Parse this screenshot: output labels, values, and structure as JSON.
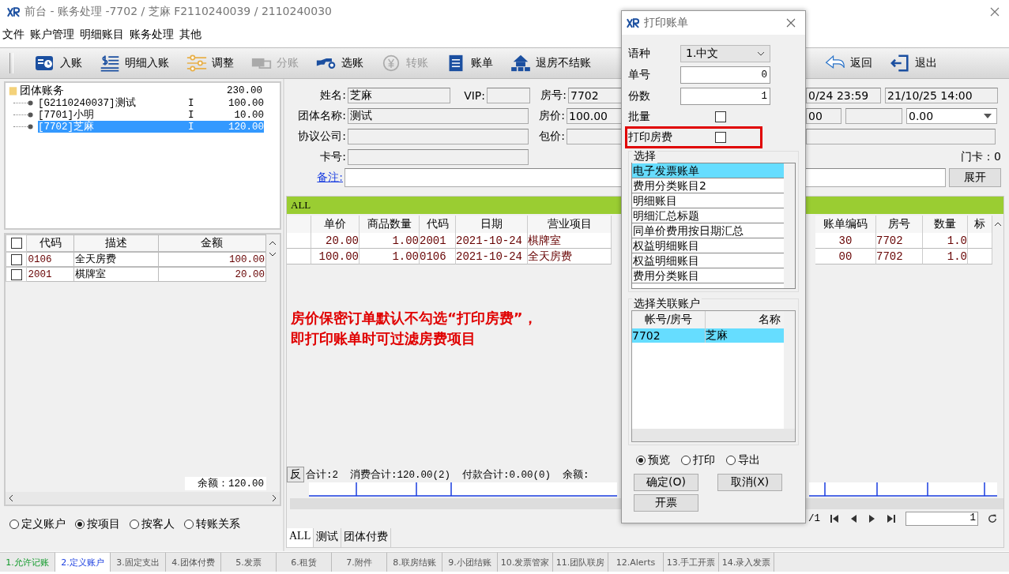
{
  "window": {
    "title": "前台 - 账务处理 -7702 / 芝麻 F2110240039 / 2110240030"
  },
  "menu": [
    "文件",
    "账户管理",
    "明细账目",
    "账务处理",
    "其他"
  ],
  "toolbar": [
    {
      "label": "入账",
      "disabled": false
    },
    {
      "label": "明细入账",
      "disabled": false
    },
    {
      "label": "调整",
      "disabled": false
    },
    {
      "label": "分账",
      "disabled": true
    },
    {
      "label": "选账",
      "disabled": false
    },
    {
      "label": "转账",
      "disabled": true
    },
    {
      "label": "账单",
      "disabled": false
    },
    {
      "label": "退房不结账",
      "disabled": false
    }
  ],
  "toolbar_right": [
    {
      "label": "返回"
    },
    {
      "label": "退出"
    }
  ],
  "account_tree": {
    "label": "团体账务",
    "amount": "230.00",
    "expanded": true,
    "children": [
      {
        "label": "[G2110240037]测试",
        "type": "I",
        "amount": "100.00",
        "selected": false
      },
      {
        "label": "[7701]小明",
        "type": "I",
        "amount": "10.00",
        "selected": false
      },
      {
        "label": "[7702]芝麻",
        "type": "I",
        "amount": "120.00",
        "selected": true
      }
    ]
  },
  "items_table": {
    "all_checked": false,
    "columns": [
      "代码",
      "描述",
      "金额"
    ],
    "rows": [
      {
        "checked": false,
        "cells": [
          "0106",
          "全天房费",
          "100.00"
        ]
      },
      {
        "checked": false,
        "cells": [
          "2001",
          "棋牌室",
          "20.00"
        ]
      }
    ],
    "balance": "余额：120.00"
  },
  "view_options": [
    {
      "label": "定义账户",
      "selected": false
    },
    {
      "label": "按项目",
      "selected": true
    },
    {
      "label": "按客人",
      "selected": false
    },
    {
      "label": "转账关系",
      "selected": false
    }
  ],
  "guest_form": {
    "rows": [
      {
        "left": [
          {
            "kind": "label",
            "text": "姓名:"
          },
          {
            "kind": "field",
            "value": "芝麻",
            "readonly": true
          },
          {
            "kind": "label",
            "text": "VIP:"
          },
          {
            "kind": "field",
            "readonly": true
          },
          {
            "kind": "label",
            "text": "房号:"
          },
          {
            "kind": "field",
            "value": "7702",
            "readonly": true
          }
        ],
        "right": [
          {
            "kind": "field",
            "value": "0/24 23:59",
            "readonly": true
          },
          {
            "kind": "field",
            "value": "21/10/25 14:00",
            "readonly": true
          }
        ]
      },
      {
        "left": [
          {
            "kind": "label",
            "text": "团体名称:"
          },
          {
            "kind": "field",
            "value": "测试",
            "readonly": true
          },
          {
            "kind": "label",
            "text": "房价:"
          },
          {
            "kind": "field",
            "value": "100.00",
            "readonly": true
          }
        ],
        "right": [
          {
            "kind": "field",
            "value": "00",
            "readonly": true
          },
          {
            "kind": "field",
            "readonly": true
          },
          {
            "kind": "select",
            "value": "0.00",
            "readonly": false
          }
        ]
      },
      {
        "left": [
          {
            "kind": "label",
            "text": "协议公司:"
          },
          {
            "kind": "field",
            "readonly": true
          },
          {
            "kind": "label",
            "text": "包价:"
          },
          {
            "kind": "field",
            "readonly": true
          }
        ],
        "right": [
          {
            "kind": "field",
            "readonly": true
          }
        ]
      },
      {
        "left": [
          {
            "kind": "label",
            "text": "卡号:"
          },
          {
            "kind": "field",
            "readonly": true
          }
        ],
        "right": [
          {
            "kind": "label",
            "text": "门卡：0"
          }
        ]
      },
      {
        "left": [
          {
            "kind": "link",
            "text": "备注:"
          },
          {
            "kind": "field",
            "readonly": false
          }
        ],
        "right": [
          {
            "kind": "button",
            "text": "展开"
          }
        ]
      }
    ]
  },
  "bill_grid": {
    "title": "ALL",
    "columns": [
      "单价",
      "商品数量",
      "代码",
      "日期",
      "营业项目"
    ],
    "right_columns": [
      "账单编码",
      "房号",
      "数量",
      "标"
    ],
    "rows": [
      {
        "cells": [
          "20.00",
          "1.00",
          "2001",
          "2021-10-24",
          "棋牌室"
        ],
        "right_cells": [
          "30",
          "7702",
          "1.0"
        ]
      },
      {
        "cells": [
          "100.00",
          "1.00",
          "0106",
          "2021-10-24",
          "全天房费"
        ],
        "right_cells": [
          "00",
          "7702",
          "1.0"
        ]
      }
    ],
    "reverse_button": "反",
    "summary": "合计:2  消费合计:120.00(2)  付款合计:0.00(0)  余额:",
    "page_count": "/1",
    "page": "1"
  },
  "view_tabs": [
    {
      "label": "ALL",
      "selected": true
    },
    {
      "label": "测试",
      "selected": false
    },
    {
      "label": "团体付费",
      "selected": false
    }
  ],
  "annotation": [
    "房价保密订单默认不勾选“打印房费”，",
    "即打印账单时可过滤房费项目"
  ],
  "status_tabs": [
    {
      "label": "1.允许记账",
      "selected": false,
      "color": "#139a2c"
    },
    {
      "label": "2.定义账户",
      "selected": true,
      "color": "#1a3ee0"
    },
    {
      "label": "3.固定支出",
      "selected": false,
      "color": "#555555"
    },
    {
      "label": "4.团体付费",
      "selected": false,
      "color": "#555555"
    },
    {
      "label": "5.发票",
      "selected": false,
      "color": "#555555"
    },
    {
      "label": "6.租赁",
      "selected": false,
      "color": "#555555"
    },
    {
      "label": "7.附件",
      "selected": false,
      "color": "#555555"
    },
    {
      "label": "8.联房结账",
      "selected": false,
      "color": "#555555"
    },
    {
      "label": "9.小团结账",
      "selected": false,
      "color": "#555555"
    },
    {
      "label": "10.发票管家",
      "selected": false,
      "color": "#555555"
    },
    {
      "label": "11.团队联房",
      "selected": false,
      "color": "#555555"
    },
    {
      "label": "12.Alerts",
      "selected": false,
      "color": "#555555"
    },
    {
      "label": "13.手工开票",
      "selected": false,
      "color": "#555555"
    },
    {
      "label": "14.录入发票",
      "selected": false,
      "color": "#555555"
    }
  ],
  "dialog": {
    "title": "打印账单",
    "language_label": "语种",
    "language": "1.中文",
    "number_label": "单号",
    "number": "0",
    "copies_label": "份数",
    "copies": "1",
    "options": [
      {
        "label": "批量",
        "checked": false,
        "highlighted": false
      },
      {
        "label": "打印房费",
        "checked": false,
        "highlighted": true
      }
    ],
    "select_group": "选择",
    "templates": [
      {
        "label": "电子发票账单",
        "selected": true
      },
      {
        "label": "费用分类账目2",
        "selected": false
      },
      {
        "label": "明细账目",
        "selected": false
      },
      {
        "label": "明细汇总标题",
        "selected": false
      },
      {
        "label": "同单价费用按日期汇总",
        "selected": false
      },
      {
        "label": "权益明细账目",
        "selected": false
      },
      {
        "label": "权益明细账目",
        "selected": false
      },
      {
        "label": "费用分类账目",
        "selected": false
      }
    ],
    "accounts_group": "选择关联账户",
    "account_columns": [
      "帐号/房号",
      "名称"
    ],
    "accounts": [
      {
        "cells": [
          "7702",
          "芝麻"
        ],
        "selected": true
      }
    ],
    "outputs": [
      {
        "label": "预览",
        "selected": true
      },
      {
        "label": "打印",
        "selected": false
      },
      {
        "label": "导出",
        "selected": false
      }
    ],
    "buttons": [
      "确定(O)",
      "取消(X)",
      "开票"
    ]
  }
}
